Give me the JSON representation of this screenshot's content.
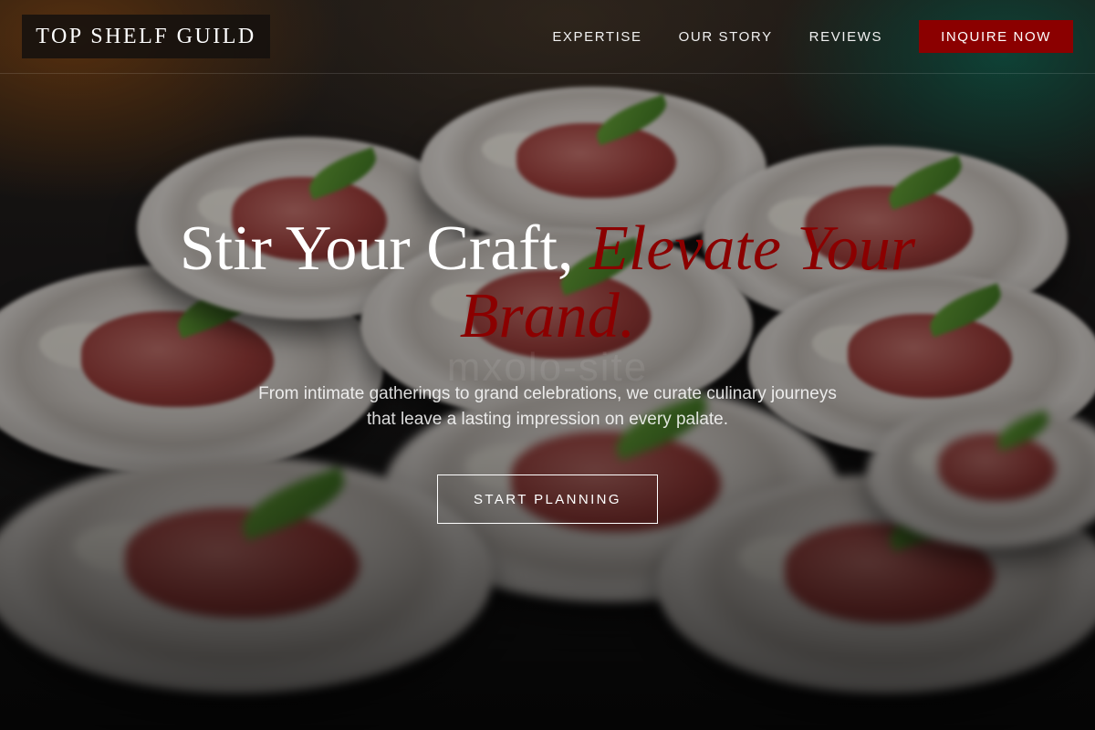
{
  "brand": {
    "logo_text": "TOP SHELF GUILD"
  },
  "nav": {
    "links": [
      "EXPERTISE",
      "OUR STORY",
      "REVIEWS"
    ],
    "cta_label": "INQUIRE NOW",
    "cta_color": "#8b0000"
  },
  "hero": {
    "headline_plain": "Stir Your Craft, ",
    "headline_accent": "Elevate Your Brand.",
    "accent_color": "#8b0000",
    "subtext": "From intimate gatherings to grand celebrations, we curate culinary journeys that leave a lasting impression on every palate.",
    "cta_label": "START PLANNING",
    "watermark": "mxolo-site"
  }
}
